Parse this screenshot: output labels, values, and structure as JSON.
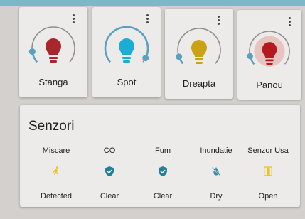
{
  "lights": [
    {
      "name": "Stanga",
      "state": "on",
      "color": "#a8262c",
      "ring_fill": 0.12
    },
    {
      "name": "Spot",
      "state": "on",
      "color": "#1aaed6",
      "ring_fill": 0.95
    },
    {
      "name": "Dreapta",
      "state": "on",
      "color": "#c9a315",
      "ring_fill": 0.08
    },
    {
      "name": "Panou",
      "state": "on",
      "color": "#b3191f",
      "ring_fill": 0.1
    }
  ],
  "sensors": {
    "title": "Senzori",
    "items": [
      {
        "label": "Miscare",
        "icon": "motion-icon",
        "value": "Detected",
        "color": "#f2c01f"
      },
      {
        "label": "CO",
        "icon": "shield-check-icon",
        "value": "Clear",
        "color": "#22809c"
      },
      {
        "label": "Fum",
        "icon": "shield-check-icon",
        "value": "Clear",
        "color": "#22809c"
      },
      {
        "label": "Inundatie",
        "icon": "water-off-icon",
        "value": "Dry",
        "color": "#3d8ca6"
      },
      {
        "label": "Senzor Usa",
        "icon": "door-open-icon",
        "value": "Open",
        "color": "#f2c01f"
      }
    ]
  },
  "theme": {
    "accent": "#5aa1bd",
    "ring_track": "#8e8e8e",
    "card_bg": "#ecebea"
  }
}
